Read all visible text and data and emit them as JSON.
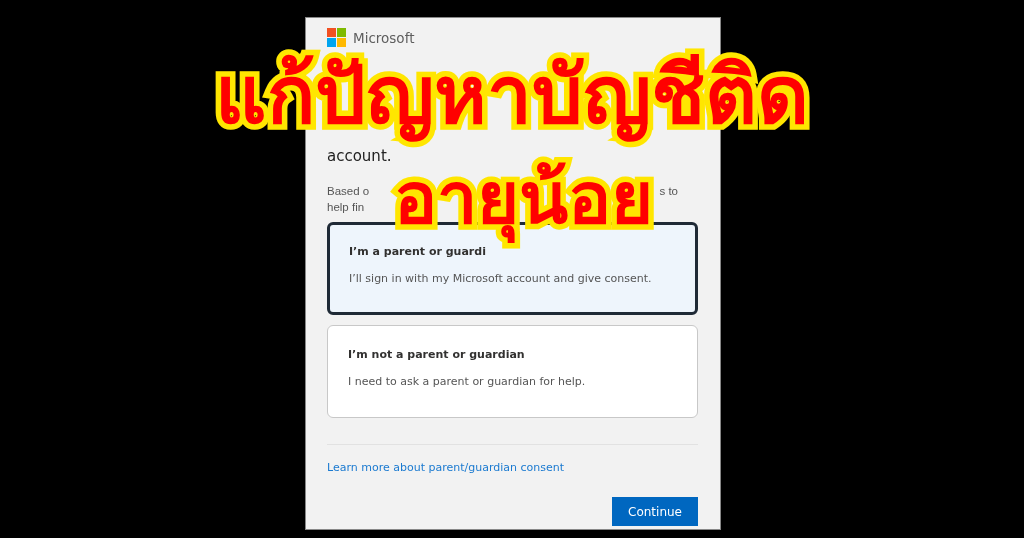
{
  "dialog": {
    "brand": "Microsoft",
    "heading": "account.",
    "description_rows": [
      [
        "Based o",
        "s to"
      ],
      [
        "help fin"
      ]
    ],
    "options": [
      {
        "title": "I’m a parent or guardi",
        "description": "I’ll sign in with my Microsoft account and give consent.",
        "selected": true
      },
      {
        "title": "I’m not a parent or guardian",
        "description": "I need to ask a parent or guardian for help.",
        "selected": false
      }
    ],
    "link": "Learn more about parent/guardian consent",
    "button": "Continue"
  },
  "overlay_title": {
    "lines": [
      "แก้ปัญหาบัญชีติด",
      "อายุน้อย"
    ]
  }
}
